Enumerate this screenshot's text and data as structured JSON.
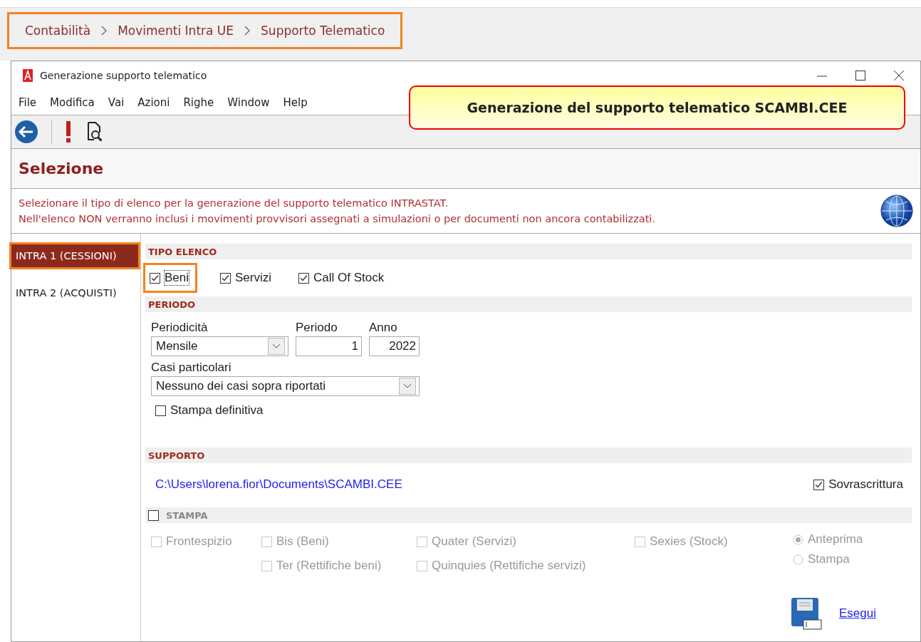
{
  "breadcrumb": {
    "highlighted": true,
    "items": [
      "Contabilità",
      "Movimenti Intra UE",
      "Supporto Telematico"
    ]
  },
  "window": {
    "title": "Generazione supporto telematico"
  },
  "menu": [
    "File",
    "Modifica",
    "Vai",
    "Azioni",
    "Righe",
    "Window",
    "Help"
  ],
  "callout": "Generazione del supporto telematico SCAMBI.CEE",
  "heading": "Selezione",
  "description": [
    "Selezionare il tipo di elenco per la generazione del supporto telematico INTRASTAT.",
    "Nell'elenco NON verranno inclusi i movimenti provvisori assegnati a simulazioni o per documenti non ancora contabilizzati."
  ],
  "sidebar": {
    "items": [
      {
        "label": "INTRA 1 (CESSIONI)",
        "selected": true,
        "highlighted": true
      },
      {
        "label": "INTRA 2 (ACQUISTI)",
        "selected": false,
        "highlighted": false
      }
    ]
  },
  "tipo_elenco": {
    "title": "TIPO ELENCO",
    "options": [
      {
        "label": "Beni",
        "checked": true,
        "focused": true,
        "highlighted": true
      },
      {
        "label": "Servizi",
        "checked": true,
        "focused": false,
        "highlighted": false
      },
      {
        "label": "Call Of Stock",
        "checked": true,
        "focused": false,
        "highlighted": false
      }
    ]
  },
  "periodo": {
    "title": "PERIODO",
    "periodicita": {
      "label": "Periodicità",
      "value": "Mensile"
    },
    "periodo": {
      "label": "Periodo",
      "value": "1"
    },
    "anno": {
      "label": "Anno",
      "value": "2022"
    },
    "casi": {
      "label": "Casi particolari",
      "value": "Nessuno dei casi sopra riportati"
    },
    "stampa_definitiva": {
      "label": "Stampa definitiva",
      "checked": false
    }
  },
  "supporto": {
    "title": "SUPPORTO",
    "path": "C:\\Users\\lorena.fior\\Documents\\SCAMBI.CEE",
    "overwrite": {
      "label": "Sovrascrittura",
      "checked": true
    }
  },
  "stampa": {
    "title": "STAMPA",
    "checked": false,
    "columns": [
      [
        {
          "label": "Frontespizio",
          "checked": false,
          "disabled": true
        }
      ],
      [
        {
          "label": "Bis (Beni)",
          "checked": false,
          "disabled": true
        },
        {
          "label": "Ter (Rettifiche beni)",
          "checked": false,
          "disabled": true
        }
      ],
      [
        {
          "label": "Quater (Servizi)",
          "checked": false,
          "disabled": true
        },
        {
          "label": "Quinquies (Rettifiche servizi)",
          "checked": false,
          "disabled": true
        }
      ],
      [
        {
          "label": "Sexies (Stock)",
          "checked": false,
          "disabled": true
        }
      ]
    ],
    "output": [
      {
        "label": "Anteprima",
        "selected": true,
        "disabled": true
      },
      {
        "label": "Stampa",
        "selected": false,
        "disabled": true
      }
    ]
  },
  "run": {
    "label": "Esegui"
  }
}
